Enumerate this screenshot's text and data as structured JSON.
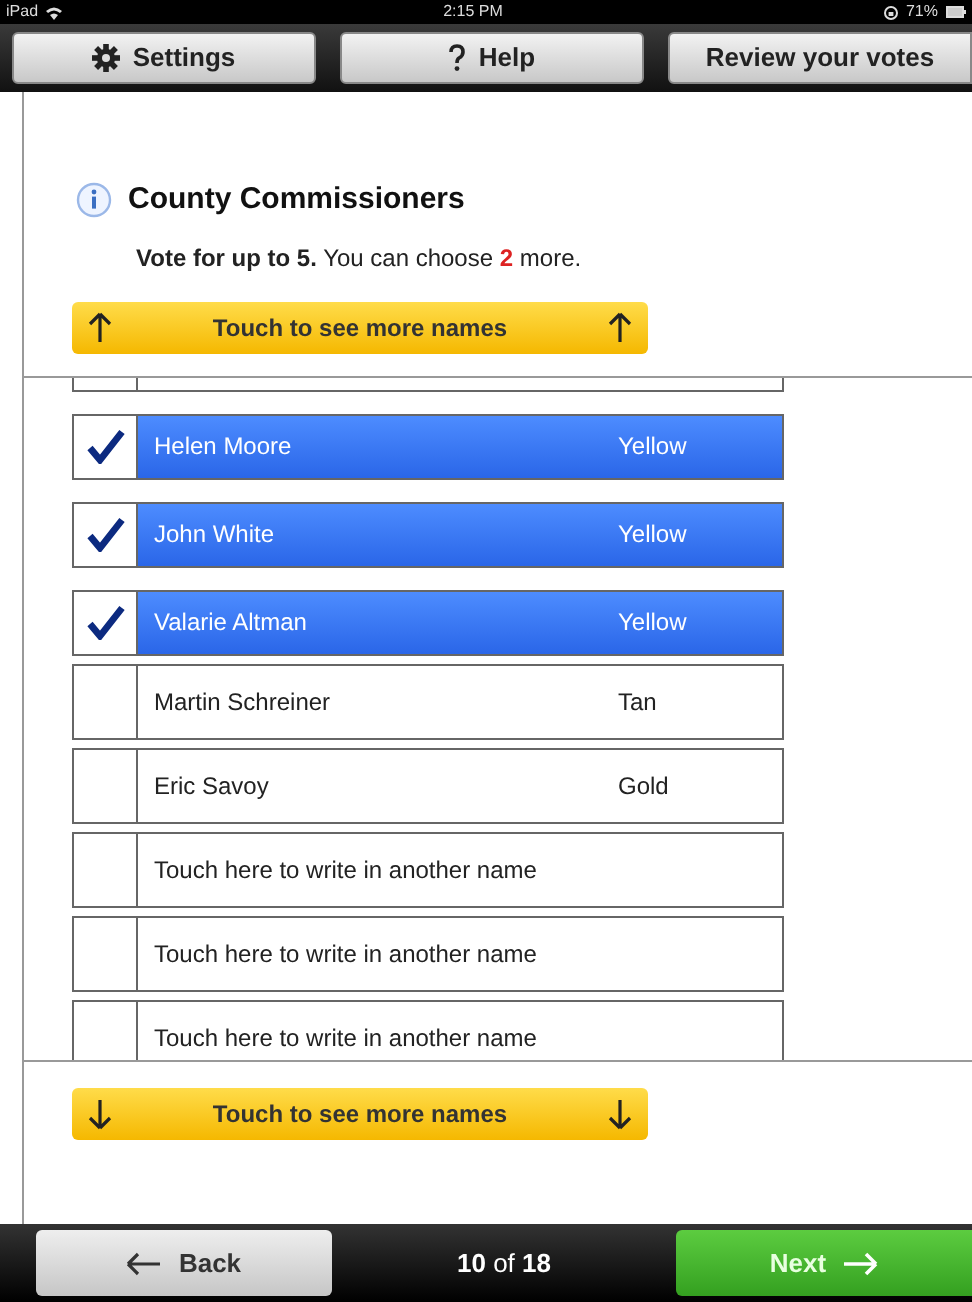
{
  "status_bar": {
    "device": "iPad",
    "time": "2:15 PM",
    "battery": "71%"
  },
  "toolbar": [
    {
      "label": "Settings"
    },
    {
      "label": "Help"
    },
    {
      "label": "Review your votes"
    }
  ],
  "contest": {
    "title": "County Commissioners",
    "instructions": "**Vote for up to 5.** You can choose **2** more."
  },
  "scroll_up": {
    "label": "Touch to see more names"
  },
  "candidates": [
    {
      "kind": "candidate",
      "name": "Helen Moore",
      "party": "Yellow",
      "selected": true
    },
    {
      "kind": "candidate",
      "name": "John White",
      "party": "Yellow",
      "selected": true
    },
    {
      "kind": "candidate",
      "name": "Valarie Altman",
      "party": "Yellow",
      "selected": true
    },
    {
      "kind": "candidate",
      "name": "Martin Schreiner",
      "party": "Tan",
      "selected": false
    },
    {
      "kind": "candidate",
      "name": "Eric Savoy",
      "party": "Gold",
      "selected": false
    },
    {
      "kind": "write_in",
      "name": "Touch here to write in another name",
      "selected": false
    },
    {
      "kind": "write_in",
      "name": "Touch here to write in another name",
      "selected": false
    },
    {
      "kind": "write_in",
      "name": "Touch here to write in another name",
      "selected": false
    }
  ],
  "scroll_down": {
    "label": "Touch to see more names"
  },
  "footer": {
    "back": "Back",
    "page": "**10** of **18**",
    "next": "Next"
  }
}
